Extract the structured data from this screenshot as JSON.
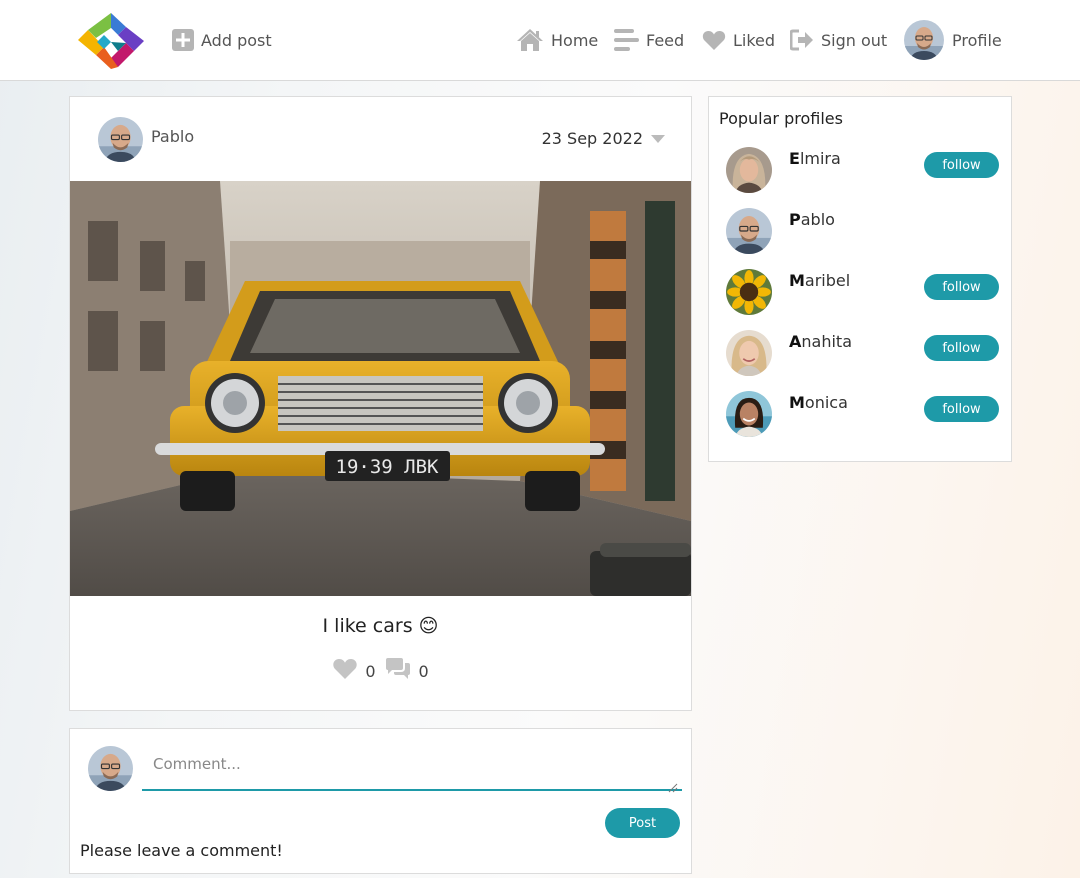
{
  "nav": {
    "add_post": "Add post",
    "home": "Home",
    "feed": "Feed",
    "liked": "Liked",
    "sign_out": "Sign out",
    "profile": "Profile"
  },
  "post": {
    "author": "Pablo",
    "date": "23 Sep 2022",
    "caption": "I like cars",
    "caption_emoji": "😊",
    "likes": "0",
    "comments": "0",
    "image_alt": "Yellow vintage car on cobblestone street",
    "plate_text": "19·39 ЛВК"
  },
  "comment": {
    "placeholder": "Comment...",
    "post_label": "Post",
    "hint": "Please leave a comment!"
  },
  "popular": {
    "title": "Popular profiles",
    "follow_label": "follow",
    "profiles": [
      {
        "initial": "E",
        "rest": "lmira",
        "show_follow": true
      },
      {
        "initial": "P",
        "rest": "ablo",
        "show_follow": false
      },
      {
        "initial": "M",
        "rest": "aribel",
        "show_follow": true
      },
      {
        "initial": "A",
        "rest": "nahita",
        "show_follow": true
      },
      {
        "initial": "M",
        "rest": "onica",
        "show_follow": true
      }
    ]
  },
  "colors": {
    "accent": "#1e9aa8",
    "icon_gray": "#b5b5b5",
    "car_yellow": "#d9a21e"
  },
  "icons": [
    "logo-icon",
    "plus-square-icon",
    "home-icon",
    "feed-icon",
    "heart-icon",
    "sign-out-icon",
    "caret-down-icon",
    "comment-icon"
  ]
}
